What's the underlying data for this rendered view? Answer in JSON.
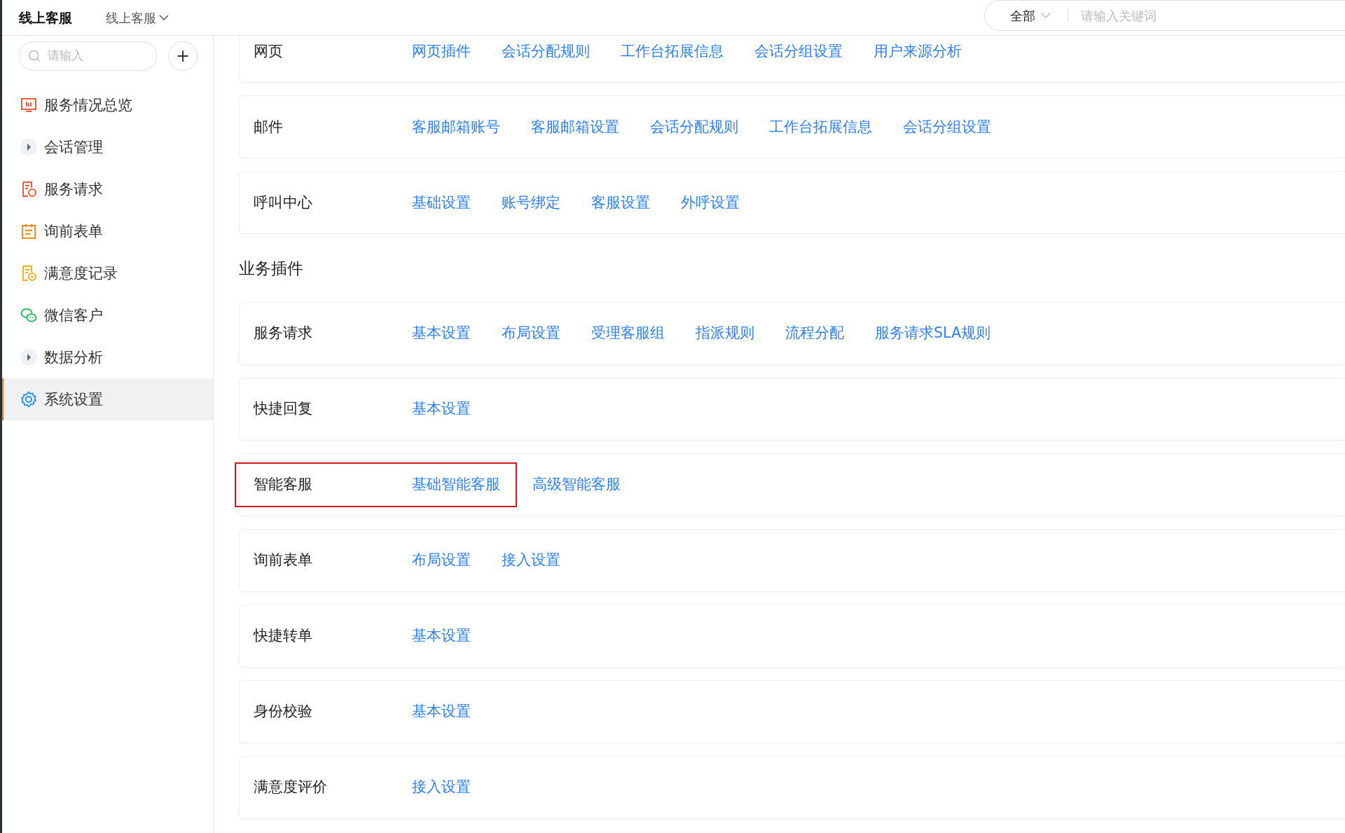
{
  "header": {
    "title": "线上客服",
    "switcher": "线上客服",
    "search": {
      "scope": "全部",
      "placeholder": "请输入关键词"
    }
  },
  "sidebar": {
    "search_placeholder": "请输入",
    "add_button": "+",
    "items": [
      {
        "label": "服务情况总览",
        "kind": "link",
        "selected": false
      },
      {
        "label": "会话管理",
        "kind": "group",
        "expanded": false,
        "selected": false
      },
      {
        "label": "服务请求",
        "kind": "link",
        "selected": false
      },
      {
        "label": "询前表单",
        "kind": "link",
        "selected": false
      },
      {
        "label": "满意度记录",
        "kind": "link",
        "selected": false
      },
      {
        "label": "微信客户",
        "kind": "link",
        "selected": false
      },
      {
        "label": "数据分析",
        "kind": "group",
        "expanded": false,
        "selected": false
      },
      {
        "label": "系统设置",
        "kind": "link",
        "selected": true
      }
    ]
  },
  "sections": [
    {
      "rows": [
        {
          "label": "网页",
          "highlighted": false,
          "links": [
            "网页插件",
            "会话分配规则",
            "工作台拓展信息",
            "会话分组设置",
            "用户来源分析"
          ]
        },
        {
          "label": "邮件",
          "highlighted": false,
          "links": [
            "客服邮箱账号",
            "客服邮箱设置",
            "会话分配规则",
            "工作台拓展信息",
            "会话分组设置"
          ]
        },
        {
          "label": "呼叫中心",
          "highlighted": false,
          "links": [
            "基础设置",
            "账号绑定",
            "客服设置",
            "外呼设置"
          ]
        }
      ]
    },
    {
      "title": "业务插件",
      "rows": [
        {
          "label": "服务请求",
          "highlighted": false,
          "links": [
            "基本设置",
            "布局设置",
            "受理客服组",
            "指派规则",
            "流程分配",
            "服务请求SLA规则"
          ]
        },
        {
          "label": "快捷回复",
          "highlighted": false,
          "links": [
            "基本设置"
          ]
        },
        {
          "label": "智能客服",
          "highlighted": true,
          "links": [
            "基础智能客服",
            "高级智能客服"
          ]
        },
        {
          "label": "询前表单",
          "highlighted": false,
          "links": [
            "布局设置",
            "接入设置"
          ]
        },
        {
          "label": "快捷转单",
          "highlighted": false,
          "links": [
            "基本设置"
          ]
        },
        {
          "label": "身份校验",
          "highlighted": false,
          "links": [
            "基本设置"
          ]
        },
        {
          "label": "满意度评价",
          "highlighted": false,
          "links": [
            "接入设置"
          ]
        }
      ]
    }
  ]
}
